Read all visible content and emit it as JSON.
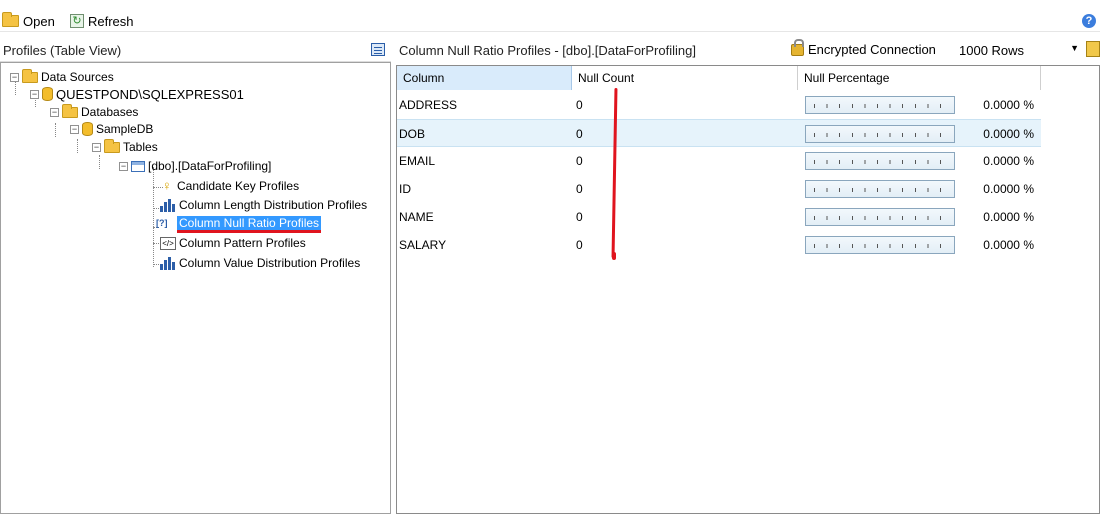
{
  "toolbar": {
    "open_label": "Open",
    "refresh_label": "Refresh",
    "help_icon": "?"
  },
  "left_panel": {
    "title": "Profiles (Table View)",
    "tree": {
      "root": "Data Sources",
      "server": "QUESTPOND\\SQLEXPRESS01",
      "databases_label": "Databases",
      "database": "SampleDB",
      "tables_label": "Tables",
      "table": "[dbo].[DataForProfiling]",
      "profiles": [
        {
          "label": "Candidate Key Profiles",
          "icon": "key-icon"
        },
        {
          "label": "Column Length Distribution Profiles",
          "icon": "bar-chart-icon"
        },
        {
          "label": "Column Null Ratio Profiles",
          "icon": "null-ratio-icon",
          "selected": true
        },
        {
          "label": "Column Pattern Profiles",
          "icon": "pattern-icon"
        },
        {
          "label": "Column Value Distribution Profiles",
          "icon": "bar-chart-icon"
        }
      ]
    }
  },
  "right_panel": {
    "title": "Column Null Ratio Profiles  -  [dbo].[DataForProfiling]",
    "connection_label": "Encrypted Connection",
    "rows_value": "1000 Rows",
    "columns": {
      "column": "Column",
      "null_count": "Null Count",
      "null_percentage": "Null Percentage"
    },
    "rows": [
      {
        "column": "ADDRESS",
        "null_count": "0",
        "null_percentage": "0.0000 %",
        "fraction": 0
      },
      {
        "column": "DOB",
        "null_count": "0",
        "null_percentage": "0.0000 %",
        "fraction": 0
      },
      {
        "column": "EMAIL",
        "null_count": "0",
        "null_percentage": "0.0000 %",
        "fraction": 0
      },
      {
        "column": "ID",
        "null_count": "0",
        "null_percentage": "0.0000 %",
        "fraction": 0
      },
      {
        "column": "NAME",
        "null_count": "0",
        "null_percentage": "0.0000 %",
        "fraction": 0
      },
      {
        "column": "SALARY",
        "null_count": "0",
        "null_percentage": "0.0000 %",
        "fraction": 0
      }
    ]
  },
  "colors": {
    "selection": "#3399ff",
    "alt_row": "#e6f3fb",
    "annotation": "#e0141e"
  }
}
